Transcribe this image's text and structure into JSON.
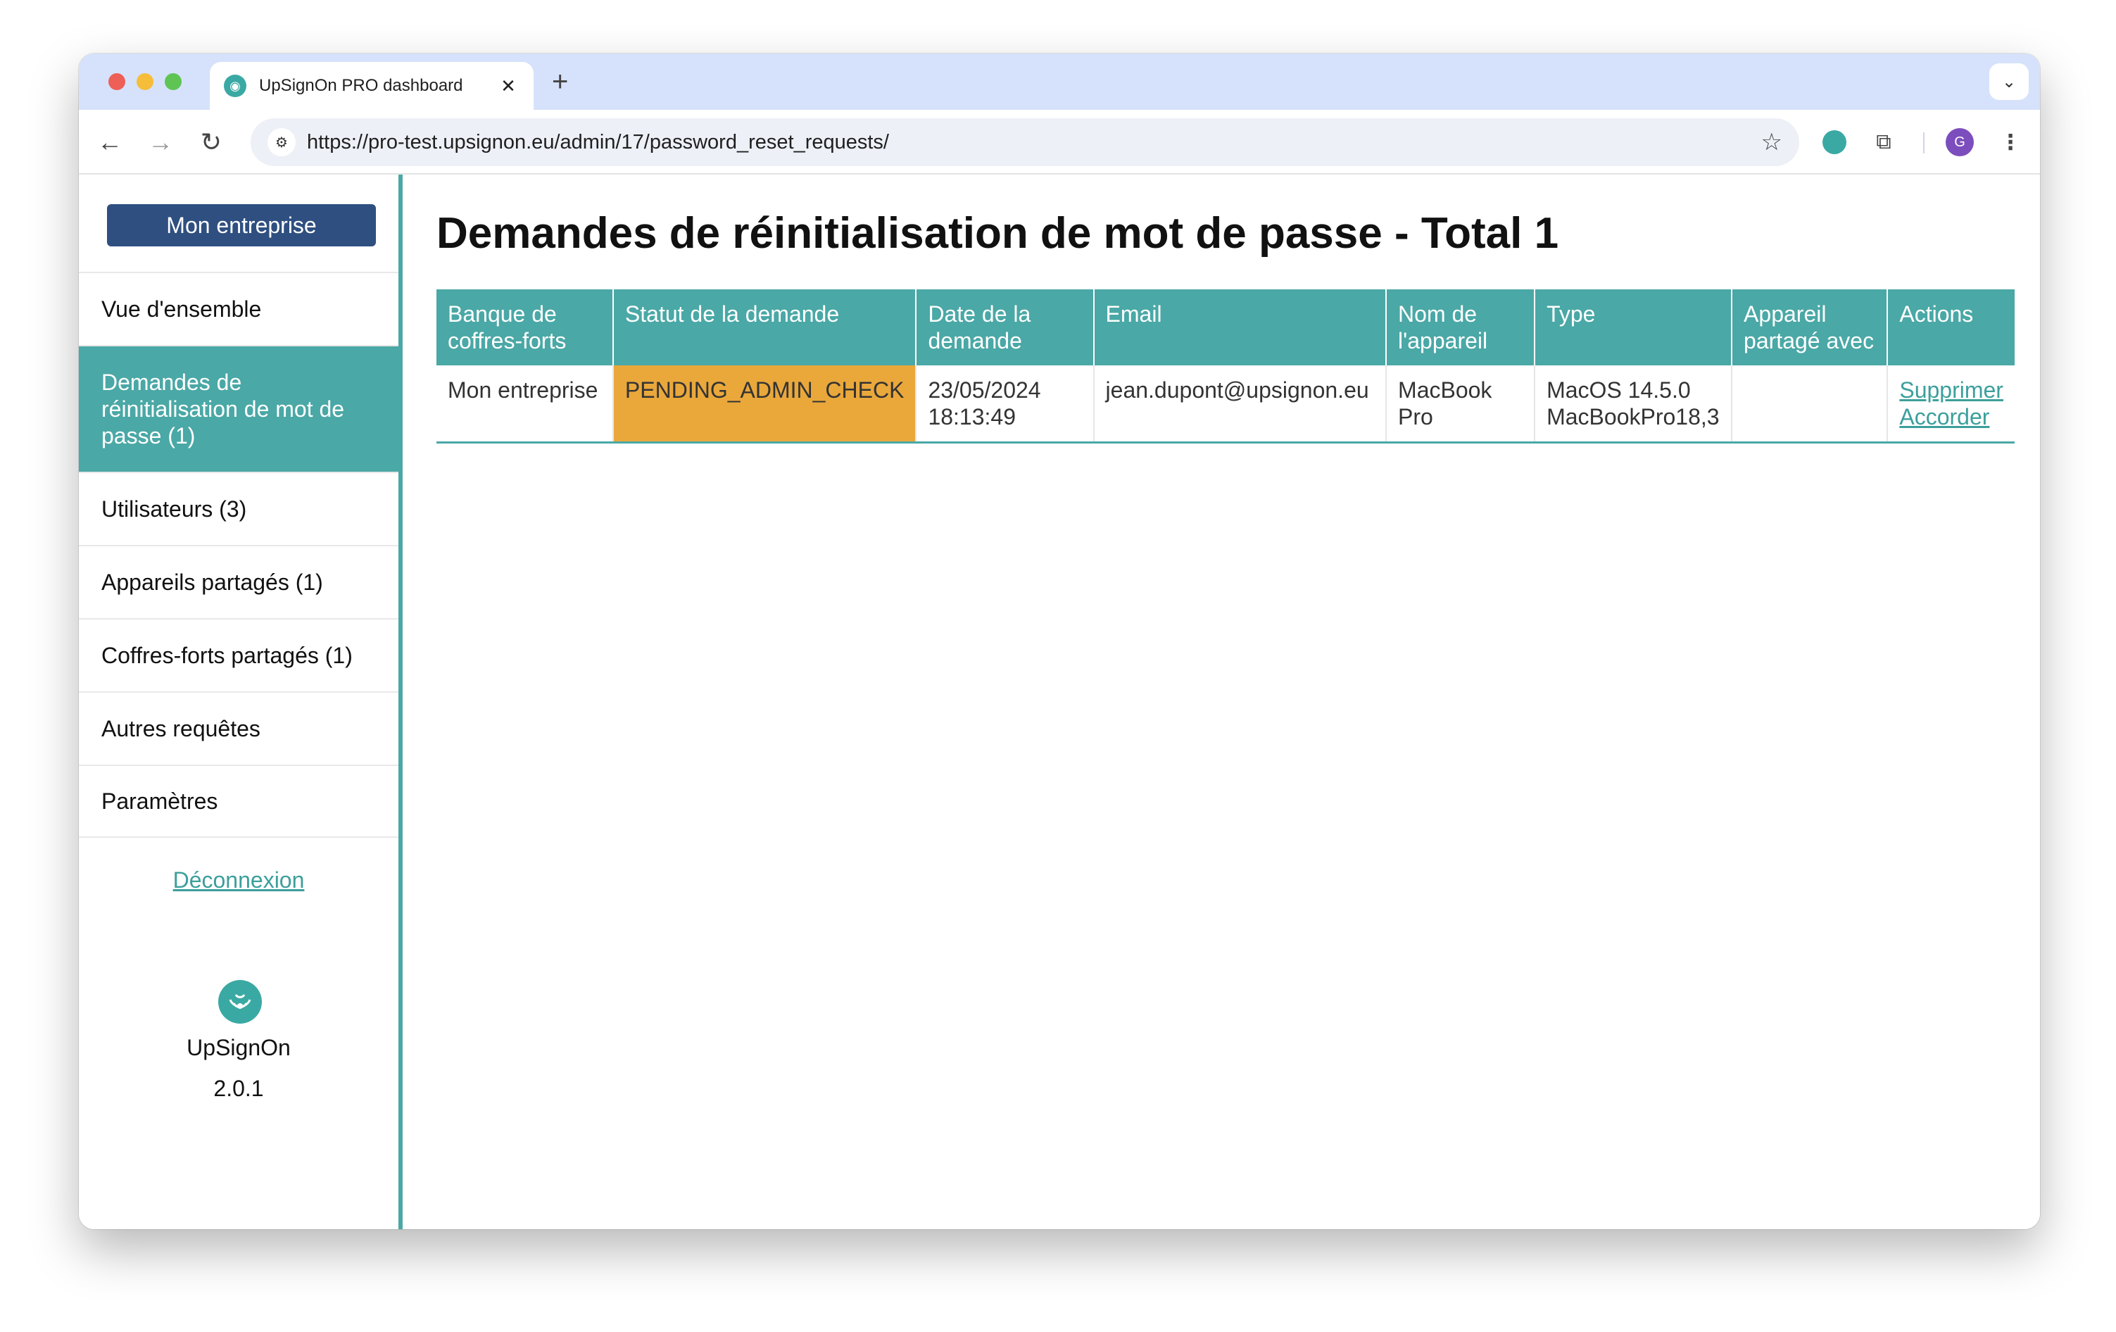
{
  "browser": {
    "tab_title": "UpSignOn PRO dashboard",
    "url": "https://pro-test.upsignon.eu/admin/17/password_reset_requests/",
    "profile_initial": "G"
  },
  "sidebar": {
    "org_button": "Mon entreprise",
    "items": [
      {
        "label": "Vue d'ensemble"
      },
      {
        "label": "Demandes de réinitialisation de mot de passe (1)"
      },
      {
        "label": "Utilisateurs (3)"
      },
      {
        "label": "Appareils partagés (1)"
      },
      {
        "label": "Coffres-forts partagés (1)"
      },
      {
        "label": "Autres requêtes"
      },
      {
        "label": "Paramètres"
      }
    ],
    "active_index": 1,
    "logout": "Déconnexion",
    "brand_name": "UpSignOn",
    "version": "2.0.1"
  },
  "main": {
    "title": "Demandes de réinitialisation de mot de passe - Total 1",
    "columns": [
      "Banque de coffres-forts",
      "Statut de la demande",
      "Date de la demande",
      "Email",
      "Nom de l'appareil",
      "Type",
      "Appareil partagé avec",
      "Actions"
    ],
    "rows": [
      {
        "bank": "Mon entreprise",
        "status": "PENDING_ADMIN_CHECK",
        "date": "23/05/2024",
        "time": "18:13:49",
        "email": "jean.dupont@upsignon.eu",
        "device_name": "MacBook Pro",
        "type_os": "MacOS 14.5.0",
        "type_model": "MacBookPro18,3",
        "shared_with": "",
        "action_delete": "Supprimer",
        "action_grant": "Accorder"
      }
    ]
  },
  "colors": {
    "accent": "#4aa8a6",
    "org_button": "#2f4f80",
    "status_pending": "#eaa83b"
  }
}
